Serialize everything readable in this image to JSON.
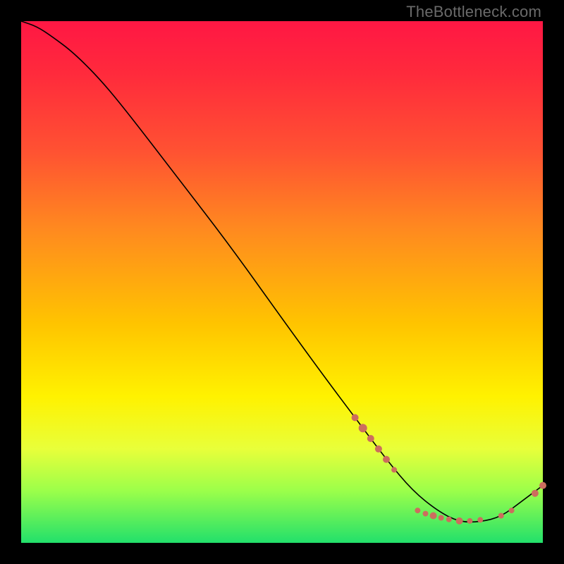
{
  "watermark": "TheBottleneck.com",
  "chart_data": {
    "type": "line",
    "title": "",
    "xlabel": "",
    "ylabel": "",
    "xlim": [
      0,
      100
    ],
    "ylim": [
      0,
      100
    ],
    "grid": false,
    "legend": false,
    "series": [
      {
        "name": "bottleneck-curve",
        "x": [
          0,
          3,
          6,
          10,
          15,
          20,
          30,
          40,
          50,
          58,
          64,
          70,
          75,
          80,
          84,
          88,
          92,
          96,
          100
        ],
        "y": [
          100,
          99,
          97,
          94,
          89,
          83,
          70,
          57,
          43,
          32,
          24,
          16,
          10,
          6,
          4,
          4,
          5,
          8,
          11
        ]
      }
    ],
    "markers": [
      {
        "name": "cluster-a",
        "x": 64,
        "y": 24,
        "r": 5
      },
      {
        "name": "cluster-a",
        "x": 65.5,
        "y": 22,
        "r": 6
      },
      {
        "name": "cluster-a",
        "x": 67,
        "y": 20,
        "r": 5
      },
      {
        "name": "cluster-a",
        "x": 68.5,
        "y": 18,
        "r": 5
      },
      {
        "name": "cluster-a",
        "x": 70,
        "y": 16,
        "r": 5
      },
      {
        "name": "cluster-a",
        "x": 71.5,
        "y": 14,
        "r": 4
      },
      {
        "name": "cluster-b",
        "x": 76,
        "y": 6.2,
        "r": 4
      },
      {
        "name": "cluster-b",
        "x": 77.5,
        "y": 5.6,
        "r": 4
      },
      {
        "name": "cluster-b",
        "x": 79,
        "y": 5.2,
        "r": 5
      },
      {
        "name": "cluster-b",
        "x": 80.5,
        "y": 4.8,
        "r": 4
      },
      {
        "name": "cluster-b",
        "x": 82,
        "y": 4.5,
        "r": 4
      },
      {
        "name": "cluster-b",
        "x": 84,
        "y": 4.2,
        "r": 5
      },
      {
        "name": "cluster-b",
        "x": 86,
        "y": 4.2,
        "r": 4
      },
      {
        "name": "cluster-b",
        "x": 88,
        "y": 4.4,
        "r": 4
      },
      {
        "name": "cluster-c",
        "x": 92,
        "y": 5.2,
        "r": 4
      },
      {
        "name": "cluster-c",
        "x": 94,
        "y": 6.2,
        "r": 4
      },
      {
        "name": "cluster-c",
        "x": 98.5,
        "y": 9.5,
        "r": 5
      },
      {
        "name": "cluster-c",
        "x": 100,
        "y": 11,
        "r": 5
      }
    ],
    "marker_color": "#cc6d5e"
  }
}
